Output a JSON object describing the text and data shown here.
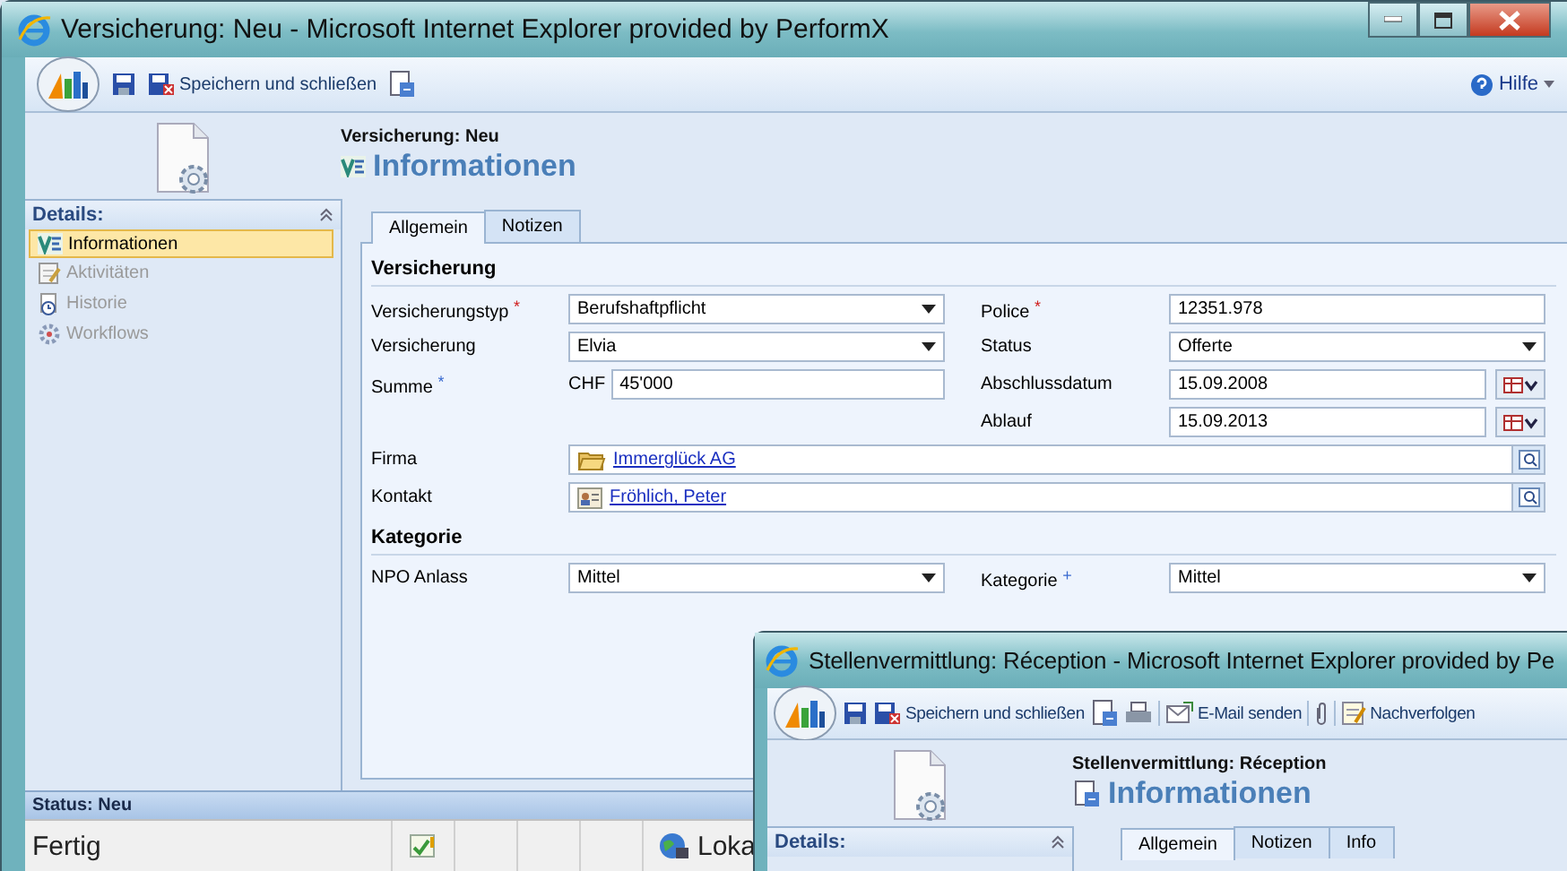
{
  "window": {
    "title": "Versicherung: Neu - Microsoft Internet Explorer provided by PerformX",
    "toolbar": {
      "save_close": "Speichern und schließen",
      "help": "Hilfe"
    },
    "header": {
      "entity": "Versicherung: Neu",
      "title": "Informationen"
    },
    "sidebar": {
      "title": "Details:",
      "items": [
        {
          "label": "Informationen",
          "selected": true,
          "disabled": false
        },
        {
          "label": "Aktivitäten",
          "selected": false,
          "disabled": true
        },
        {
          "label": "Historie",
          "selected": false,
          "disabled": true
        },
        {
          "label": "Workflows",
          "selected": false,
          "disabled": true
        }
      ]
    },
    "tabs": [
      {
        "label": "Allgemein",
        "selected": true
      },
      {
        "label": "Notizen",
        "selected": false
      }
    ],
    "sections": [
      {
        "title": "Versicherung",
        "rows": [
          {
            "left": {
              "label": "Versicherungstyp",
              "mark": {
                "text": "*",
                "color": "#d02020"
              },
              "kind": "select",
              "value": "Berufshaftpflicht"
            },
            "right": {
              "label": "Police",
              "mark": {
                "text": "*",
                "color": "#d02020"
              },
              "kind": "text",
              "value": "12351.978"
            }
          },
          {
            "left": {
              "label": "Versicherung",
              "kind": "select",
              "value": "Elvia"
            },
            "right": {
              "label": "Status",
              "kind": "select",
              "value": "Offerte"
            }
          },
          {
            "left": {
              "label": "Summe",
              "mark": {
                "text": "*",
                "color": "#3a6ad0"
              },
              "kind": "currency",
              "prefix": "CHF",
              "value": "45'000"
            },
            "right": {
              "label": "Abschlussdatum",
              "kind": "date",
              "value": "15.09.2008"
            }
          },
          {
            "right": {
              "label": "Ablauf",
              "kind": "date",
              "value": "15.09.2013"
            }
          },
          {
            "full": {
              "label": "Firma",
              "kind": "account",
              "value": "Immerglück AG"
            }
          },
          {
            "full": {
              "label": "Kontakt",
              "kind": "contact",
              "value": "Fröhlich, Peter"
            }
          }
        ]
      },
      {
        "title": "Kategorie",
        "rows": [
          {
            "left": {
              "label": "NPO Anlass",
              "kind": "select",
              "value": "Mittel"
            },
            "right": {
              "label": "Kategorie",
              "mark": {
                "text": "+",
                "color": "#3a6ad0"
              },
              "kind": "select",
              "value": "Mittel"
            }
          }
        ]
      }
    ],
    "form_status": "Status: Neu",
    "status_bar": {
      "text": "Fertig",
      "zone": "Loka"
    }
  },
  "second_window": {
    "title": "Stellenvermittlung: Réception - Microsoft Internet Explorer provided by Pe",
    "toolbar": {
      "save_close": "Speichern und schließen",
      "email": "E-Mail senden",
      "follow_up": "Nachverfolgen"
    },
    "header": {
      "entity": "Stellenvermittlung: Réception",
      "title": "Informationen"
    },
    "sidebar": {
      "title": "Details:"
    },
    "tabs": [
      {
        "label": "Allgemein",
        "selected": true
      },
      {
        "label": "Notizen",
        "selected": false
      },
      {
        "label": "Info",
        "selected": false
      }
    ]
  }
}
